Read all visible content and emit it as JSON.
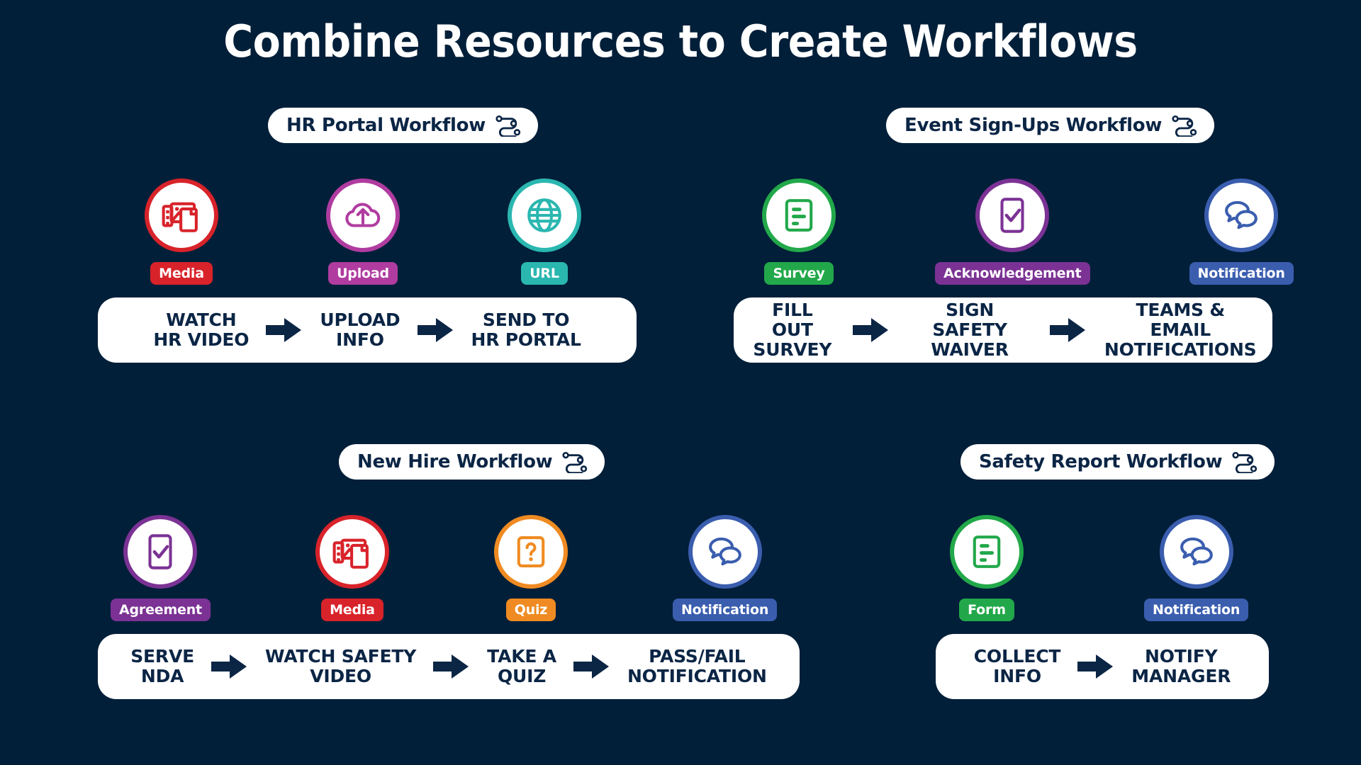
{
  "title": "Combine Resources to Create Workflows",
  "theme": {
    "background": "#011f39",
    "panel": "#ffffff",
    "text_dark": "#0b2545"
  },
  "workflows": [
    {
      "id": "hr-portal",
      "name": "HR Portal Workflow",
      "pill_icon": "workflow-node-icon",
      "nodes": [
        {
          "icon": "media-icon",
          "label": "Media",
          "color": "#d8232a"
        },
        {
          "icon": "upload-icon",
          "label": "Upload",
          "color": "#b03ca0"
        },
        {
          "icon": "url-icon",
          "label": "URL",
          "color": "#2ab7b0"
        }
      ],
      "steps": [
        "WATCH\nHR VIDEO",
        "UPLOAD\nINFO",
        "SEND TO\nHR PORTAL"
      ]
    },
    {
      "id": "event-sign-ups",
      "name": "Event Sign-Ups Workflow",
      "pill_icon": "workflow-node-icon",
      "nodes": [
        {
          "icon": "survey-icon",
          "label": "Survey",
          "color": "#22a84a"
        },
        {
          "icon": "acknowledgement-icon",
          "label": "Acknowledgement",
          "color": "#7b3294"
        },
        {
          "icon": "notification-icon",
          "label": "Notification",
          "color": "#3a5dae"
        }
      ],
      "steps": [
        "FILL OUT\nSURVEY",
        "SIGN SAFETY\nWAIVER",
        "TEAMS & EMAIL\nNOTIFICATIONS"
      ]
    },
    {
      "id": "new-hire",
      "name": "New Hire Workflow",
      "pill_icon": "workflow-node-icon",
      "nodes": [
        {
          "icon": "agreement-icon",
          "label": "Agreement",
          "color": "#7b3294"
        },
        {
          "icon": "media-icon",
          "label": "Media",
          "color": "#d8232a"
        },
        {
          "icon": "quiz-icon",
          "label": "Quiz",
          "color": "#ef8b22"
        },
        {
          "icon": "notification-icon",
          "label": "Notification",
          "color": "#3a5dae"
        }
      ],
      "steps": [
        "SERVE\nNDA",
        "WATCH SAFETY\nVIDEO",
        "TAKE A\nQUIZ",
        "PASS/FAIL\nNOTIFICATION"
      ]
    },
    {
      "id": "safety-report",
      "name": "Safety Report Workflow",
      "pill_icon": "workflow-node-icon",
      "nodes": [
        {
          "icon": "form-icon",
          "label": "Form",
          "color": "#22a84a"
        },
        {
          "icon": "notification-icon",
          "label": "Notification",
          "color": "#3a5dae"
        }
      ],
      "steps": [
        "COLLECT\nINFO",
        "NOTIFY\nMANAGER"
      ]
    }
  ]
}
